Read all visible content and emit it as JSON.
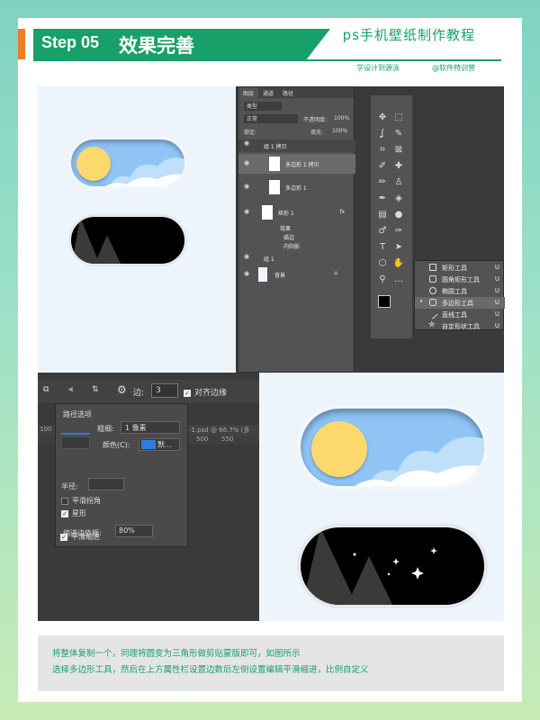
{
  "header": {
    "step": "Step 05",
    "title": "效果完善",
    "brand": "ps手机壁纸制作教程",
    "tagline": "学设计到源泳",
    "author": "@软件特训营"
  },
  "layers_panel": {
    "tabs": [
      "图层",
      "通道",
      "路径"
    ],
    "kind": "类型",
    "blend": "正常",
    "opacity_label": "不透明度:",
    "opacity": "100%",
    "lock_label": "锁定:",
    "fill_label": "填充:",
    "fill": "100%",
    "layers": [
      {
        "name": "组 1 拷贝"
      },
      {
        "name": "多边形 1 拷贝"
      },
      {
        "name": "多边形 1"
      },
      {
        "name": "矩形 1"
      },
      {
        "name": "效果"
      },
      {
        "name": "描边"
      },
      {
        "name": "内阴影"
      },
      {
        "name": "组 1"
      },
      {
        "name": "背景"
      }
    ],
    "fx": "fx"
  },
  "shape_flyout": {
    "items": [
      {
        "label": "矩形工具",
        "key": "U"
      },
      {
        "label": "圆角矩形工具",
        "key": "U"
      },
      {
        "label": "椭圆工具",
        "key": "U"
      },
      {
        "label": "多边形工具",
        "key": "U"
      },
      {
        "label": "直线工具",
        "key": "U"
      },
      {
        "label": "自定形状工具",
        "key": "U"
      }
    ]
  },
  "options_bar": {
    "sides_label": "边:",
    "sides_value": "3",
    "align_label": "对齐边缘"
  },
  "path_options": {
    "title": "路径选项",
    "weight_label": "粗细:",
    "weight_value": "1 像素",
    "color_label": "颜色(C):",
    "color_value": "默...",
    "radius_label": "半径:",
    "smooth_corners": "平滑拐角",
    "star": "星形",
    "indent_label": "缩进边依据:",
    "indent_value": "80%",
    "smooth_indents": "平滑缩进"
  },
  "ruler": {
    "left": "100",
    "tab": "-1.psd @ 66.7% (多",
    "ticks": [
      "500",
      "450",
      "550"
    ]
  },
  "footer": {
    "line1": "将整体复制一个，同理将圆变为三角形做剪贴蒙版即可，如图所示",
    "line2": "选择多边形工具，然后在上方属性栏设置边数后左侧设置编辑平滑缩进，比例自定义"
  },
  "colors": {
    "accent": "#17a06a",
    "orange": "#f07b28",
    "sun": "#fdd96d",
    "sky": "#8fc4f5"
  }
}
